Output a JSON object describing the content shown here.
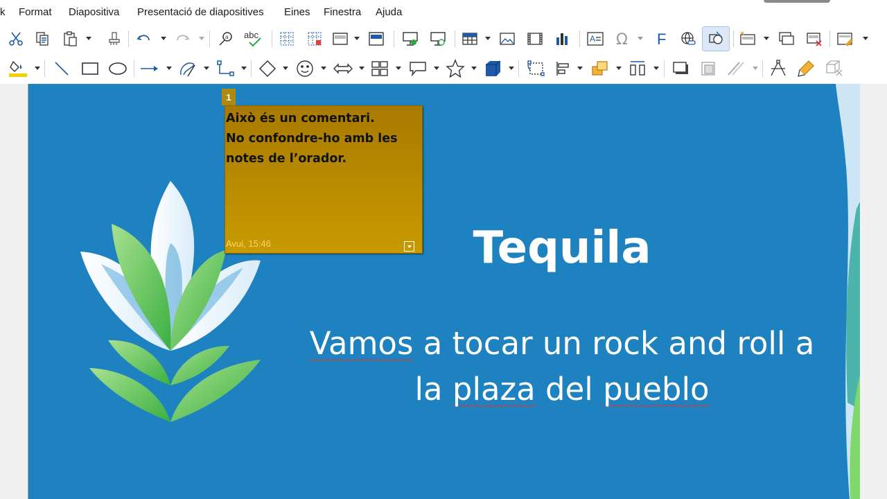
{
  "menubar": {
    "items": [
      "k",
      "Format",
      "Diapositiva",
      "Presentació de diapositives",
      "Eines",
      "Finestra",
      "Ajuda"
    ]
  },
  "toolbar_standard": {
    "buttons": [
      "cut-icon",
      "copy-icon",
      "paste-icon",
      "clone-formatting-icon",
      "undo-icon",
      "redo-icon",
      "find-replace-icon",
      "spelling-icon",
      "display-grid-icon",
      "helplines-icon",
      "display-views-icon",
      "master-slide-icon",
      "start-from-first-icon",
      "start-from-current-icon",
      "table-icon",
      "image-icon",
      "media-icon",
      "chart-icon",
      "text-box-icon",
      "special-character-icon",
      "fontwork-icon",
      "hyperlink-icon",
      "show-draw-functions-icon",
      "new-slide-icon",
      "duplicate-slide-icon",
      "delete-slide-icon",
      "slide-layout-icon"
    ]
  },
  "toolbar_drawing": {
    "buttons": [
      "fill-color-icon",
      "line-icon",
      "rectangle-icon",
      "ellipse-icon",
      "line-ends-arrow-icon",
      "curves-polygons-icon",
      "connectors-icon",
      "basic-shapes-icon",
      "symbol-shapes-icon",
      "block-arrows-icon",
      "flowchart-icon",
      "callouts-icon",
      "stars-icon",
      "3d-objects-icon",
      "rotate-icon",
      "align-icon",
      "arrange-icon",
      "distribute-icon",
      "shadow-icon",
      "crop-icon",
      "filter-icon",
      "points-icon",
      "glue-points-icon",
      "toggle-extrusion-icon"
    ],
    "accent_fill": "#f3d000"
  },
  "slide": {
    "background": "#1f82c0",
    "title": "Tequila",
    "subtitle_parts": [
      "Vamos",
      " a tocar un rock  and roll a la ",
      "plaza",
      " del ",
      "pueblo"
    ]
  },
  "comment": {
    "number": "1",
    "text": "Això és un comentari.\nNo confondre-ho amb les notes de l’orador.",
    "date": "Avui, 15:46"
  }
}
